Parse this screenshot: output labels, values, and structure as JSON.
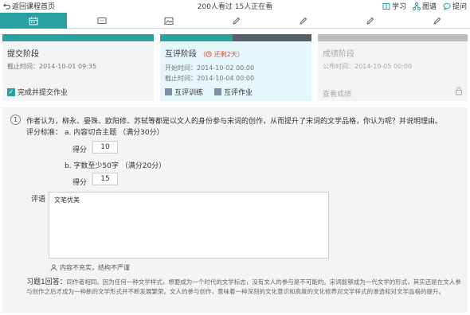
{
  "header": {
    "back_label": "返回课程首页",
    "viewers": "200人看过 15人正在看",
    "links": [
      {
        "icon": "book-icon",
        "label": "学习"
      },
      {
        "icon": "network-icon",
        "label": "图谱"
      },
      {
        "icon": "chat-icon",
        "label": "提问"
      }
    ]
  },
  "tabs": [
    {
      "icon": "calendar-icon",
      "active": true
    },
    {
      "icon": "message-icon",
      "active": false
    },
    {
      "icon": "image-icon",
      "active": false
    },
    {
      "icon": "pencil-icon",
      "active": false
    },
    {
      "icon": "pencil-icon",
      "active": false
    },
    {
      "icon": "pencil-icon",
      "active": false
    },
    {
      "icon": "pencil-icon",
      "active": false
    }
  ],
  "stages": {
    "submit": {
      "title": "提交阶段",
      "deadline": "截止时间：2014-10-01 09:35",
      "done_label": "完成并提交作业"
    },
    "peer": {
      "title": "互评阶段",
      "remaining": "还剩2天",
      "start": "开始时间：2014-10-02 00:00",
      "deadline": "截止时间：2014-10-04 00:00",
      "training_label": "互评训练",
      "homework_label": "互评作业"
    },
    "result": {
      "title": "成绩阶段",
      "publish": "公布时间：2014-10-05 00:00",
      "view_label": "查看成绩"
    }
  },
  "question": {
    "number": "1",
    "text": "作者认为，柳永、晏殊、欧阳修、苏轼等都是以文人的身份参与宋词的创作，从而提升了宋词的文学品格，你认为呢？并说明理由。",
    "criteria_label": "评分标准：",
    "criterion_a": "a. 内容切合主题 （满分30分）",
    "criterion_b": "b. 字数至少50字 （满分20分）",
    "score_label": "得分",
    "score_a": "10",
    "score_b": "15",
    "comment_label": "评语",
    "comment_text": "文笔优美",
    "reviewer_note": "内容不充实，结构不严谨",
    "answer_label": "习题1回答：",
    "answer_text": "同作者相同。因为任何一种文学样式，想要成为一个时代的文学标志，没有文人的参与是不可能的。宋词能够成为一代文学的形式，其实还是在文人参与创作之后才成为一种新的文学形式并不断发展繁荣。文人的参与创作，意味着一种深刻的文化意识和高度的文化修养对文学样式的渗透和对文学品格的提升。"
  },
  "colors": {
    "accent": "#2aa1a1",
    "remaining": "#e74c3c"
  }
}
